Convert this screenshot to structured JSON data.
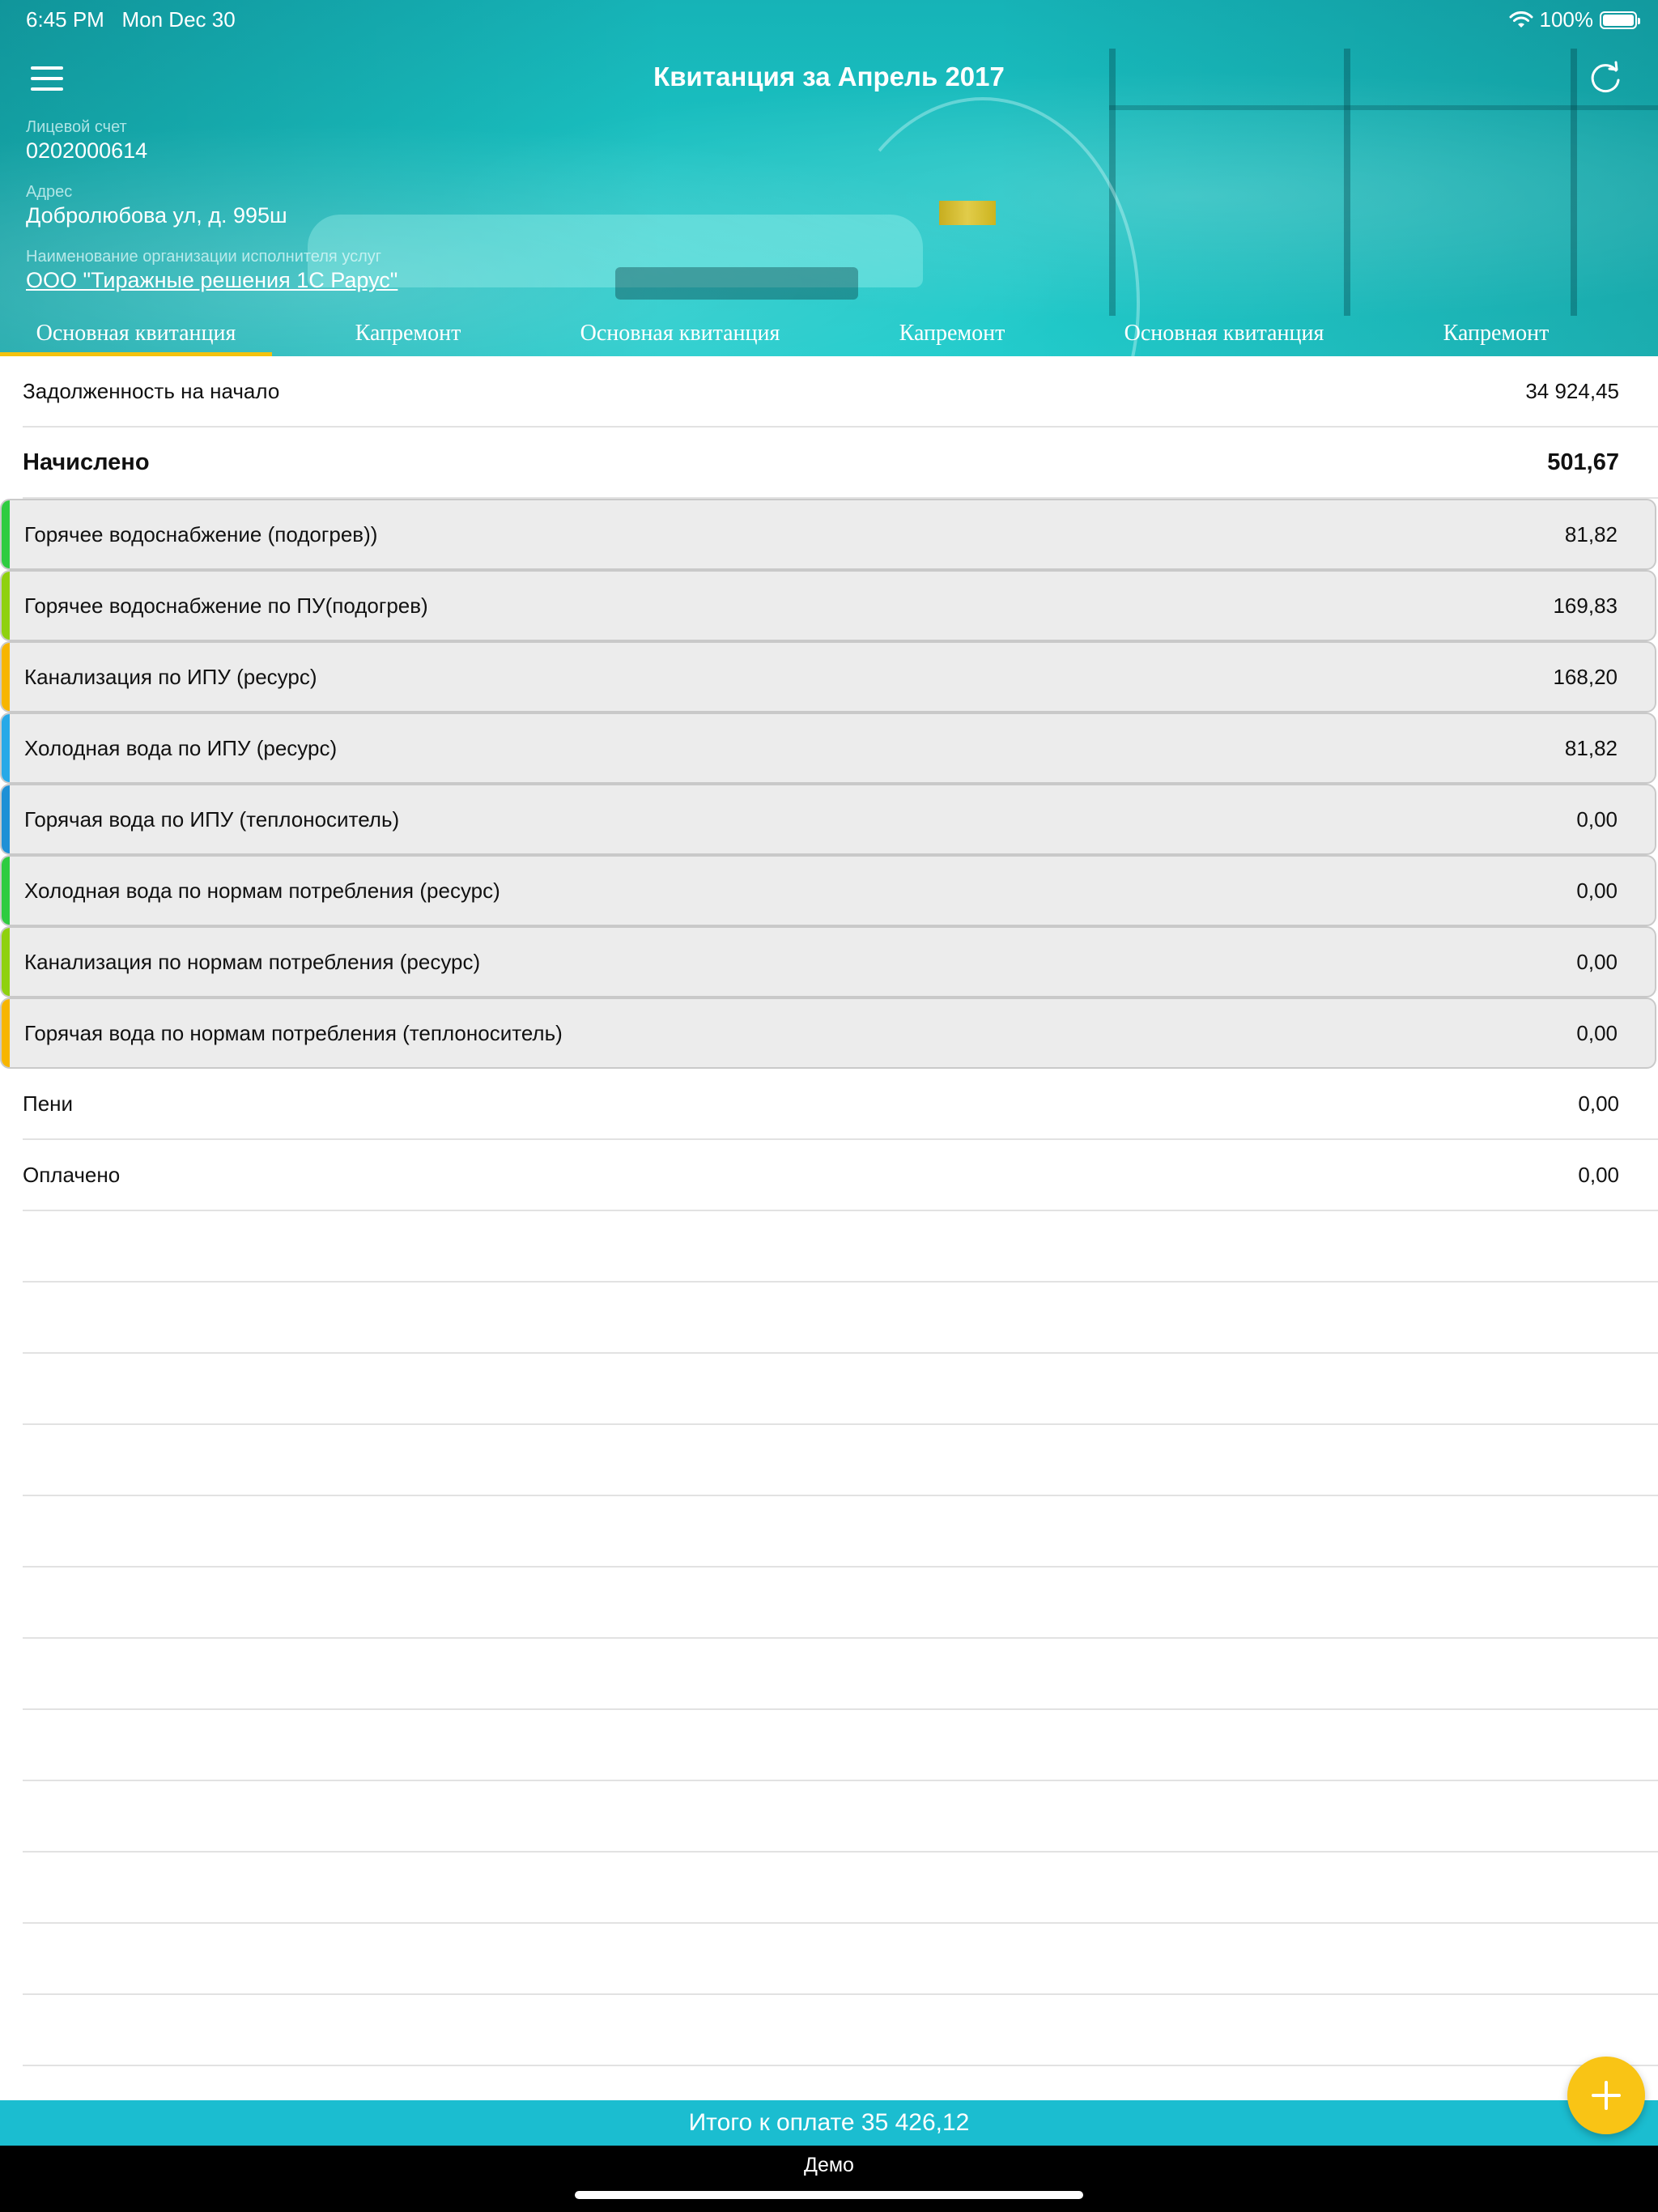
{
  "status_bar": {
    "time": "6:45 PM",
    "date": "Mon Dec 30",
    "battery": "100%"
  },
  "nav": {
    "title": "Квитанция за Апрель 2017",
    "menu_icon": "hamburger-menu-icon",
    "refresh_icon": "refresh-icon"
  },
  "account": {
    "label": "Лицевой счет",
    "value": "0202000614"
  },
  "address": {
    "label": "Адрес",
    "value": "Добролюбова ул, д. 995ш"
  },
  "organization": {
    "label": "Наименование организации исполнителя услуг",
    "value": "ООО \"Тиражные решения 1С Рарус\""
  },
  "tabs": [
    {
      "label": "Основная квитанция",
      "active": true
    },
    {
      "label": "Капремонт",
      "active": false
    },
    {
      "label": "Основная квитанция",
      "active": false
    },
    {
      "label": "Капремонт",
      "active": false
    },
    {
      "label": "Основная квитанция",
      "active": false
    },
    {
      "label": "Капремонт",
      "active": false
    }
  ],
  "summary": {
    "debt": {
      "label": "Задолженность на начало",
      "value": "34 924,45"
    },
    "charged": {
      "label": "Начислено",
      "value": "501,67"
    },
    "penalty": {
      "label": "Пени",
      "value": "0,00"
    },
    "paid": {
      "label": "Оплачено",
      "value": "0,00"
    }
  },
  "services": [
    {
      "label": "Горячее водоснабжение (подогрев))",
      "value": "81,82",
      "color": "#2ecc40"
    },
    {
      "label": "Горячее водоснабжение по ПУ(подогрев)",
      "value": "169,83",
      "color": "#8fd10f"
    },
    {
      "label": "Канализация по ИПУ (ресурс)",
      "value": "168,20",
      "color": "#f7b500"
    },
    {
      "label": "Холодная вода по ИПУ (ресурс)",
      "value": "81,82",
      "color": "#27a9e8"
    },
    {
      "label": "Горячая вода по ИПУ (теплоноситель)",
      "value": "0,00",
      "color": "#1e90d6"
    },
    {
      "label": "Холодная вода по нормам потребления (ресурс)",
      "value": "0,00",
      "color": "#2ecc40"
    },
    {
      "label": "Канализация по нормам потребления (ресурс)",
      "value": "0,00",
      "color": "#8fd10f"
    },
    {
      "label": "Горячая вода по нормам потребления (теплоноситель)",
      "value": "0,00",
      "color": "#f7b500"
    }
  ],
  "total": {
    "text": "Итого к оплате 35 426,12"
  },
  "demo": {
    "label": "Демо"
  },
  "fab": {
    "icon": "plus-icon"
  },
  "colors": {
    "accent": "#f4c20d",
    "total_bar": "#1bbdd0",
    "header": "#1ac2c2"
  }
}
